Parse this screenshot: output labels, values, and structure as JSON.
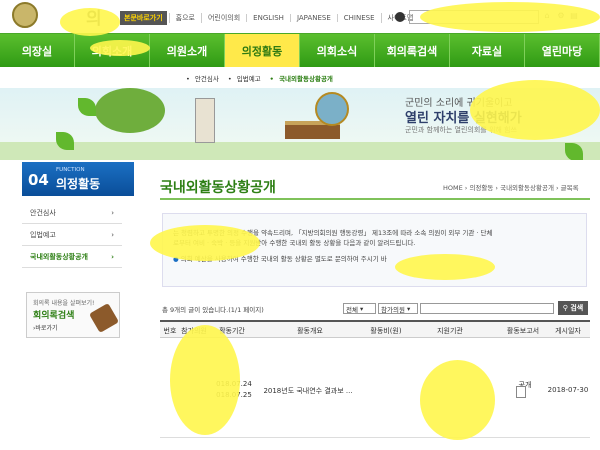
{
  "header": {
    "logo_text": "의회",
    "home_link": "본문바로가기",
    "links": [
      "홈으로",
      "어린이의회",
      "ENGLISH",
      "JAPANESE",
      "CHINESE",
      "사이트맵"
    ],
    "tool_icons": [
      "home-icon",
      "gear-icon",
      "print-icon"
    ]
  },
  "nav": {
    "items": [
      "의장실",
      "의회소개",
      "의원소개",
      "의정활동",
      "의회소식",
      "회의록검색",
      "자료실",
      "열린마당"
    ],
    "active": "의정활동"
  },
  "subnav": {
    "items": [
      "안건심사",
      "입법예고",
      "국내외활동상황공개"
    ]
  },
  "banner": {
    "line1": "군민의 소리에 귀기울이고",
    "line2": "열린 자치를 실현해가",
    "line3": "군민과 함께하는 열린의회를 위해 힘쓰"
  },
  "sidebar": {
    "number": "04",
    "function_label": "FUNCTION",
    "title": "의정활동",
    "items": [
      "안건심사",
      "입법예고",
      "국내외활동상황공개"
    ],
    "box": {
      "line1": "회의록 내용을 살펴보기!",
      "line2": "회의록검색",
      "line3": "›바로가기"
    }
  },
  "content": {
    "title": "국내외활동상황공개",
    "breadcrumb": "HOME › 의정활동 › 국내외활동상황공개 › 글목록",
    "notice": {
      "line1": "는 청렴하고 투명한 의정 수행을 약속드리며, 「지방의회의원 행동강령」 제13조에 따라 소속 의원이 외부 기관 · 단체",
      "line2": "로부터 여비 · 숙박 · 등을 지원받아 수행한 국내외 활동 상황을 다음과 같이 알려드립니다.",
      "line3": "의회 예산을 사용하여 수행한 국내외 활동 상황은 별도로 문의하여 주시기 바"
    },
    "count_text": "총 9개의 글이 있습니다.(1/1 페이지)",
    "search": {
      "select1": "전체",
      "select2": "참가의원",
      "button": "검색"
    },
    "table": {
      "headers": [
        "번호",
        "참가의원",
        "활동기간",
        "활동개요",
        "활동비(원)",
        "지원기관",
        "활동보고서",
        "게시일자"
      ],
      "rows": [
        {
          "period_start": "018.07.24",
          "period_end": "018.07.25",
          "summary": "2018년도 국내연수 결과보 ...",
          "report": "공개",
          "posted": "2018-07-30"
        }
      ]
    }
  }
}
